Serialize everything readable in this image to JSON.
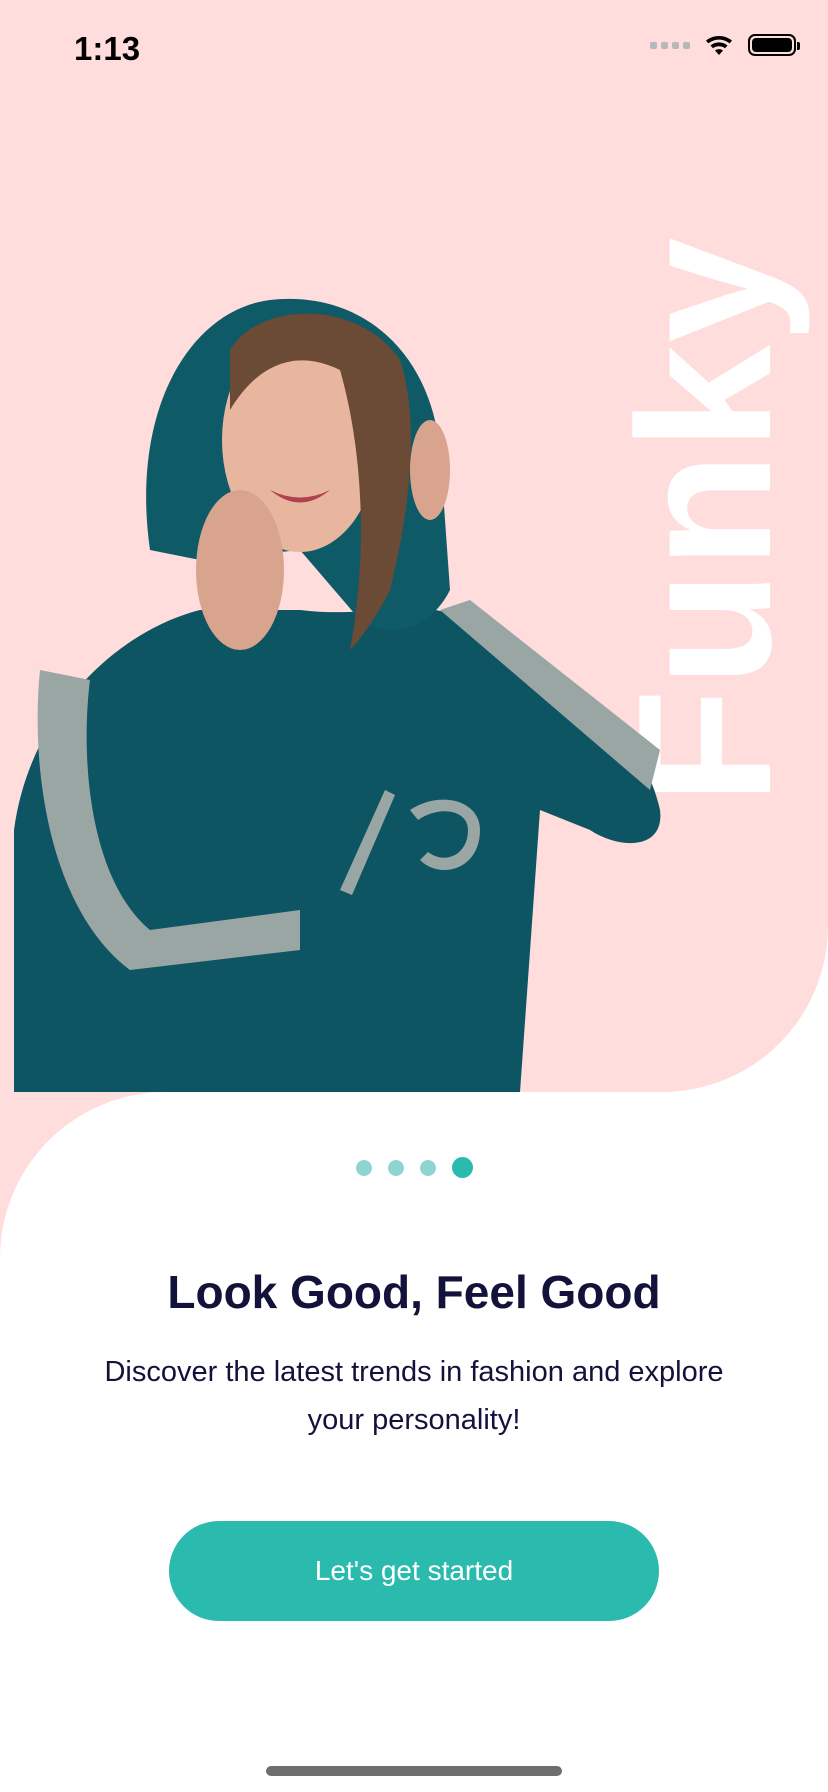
{
  "status_bar": {
    "time": "1:13"
  },
  "hero": {
    "brand_word": "Funky"
  },
  "pager": {
    "count": 4,
    "active_index": 3
  },
  "onboarding": {
    "title": "Look Good, Feel Good",
    "description": "Discover the latest trends in fashion and explore your personality!",
    "cta_label": "Let's get started"
  },
  "colors": {
    "hero_background": "#ffdddd",
    "accent": "#2bbaae",
    "accent_light": "#8ed5d1",
    "text_dark": "#12123a"
  }
}
